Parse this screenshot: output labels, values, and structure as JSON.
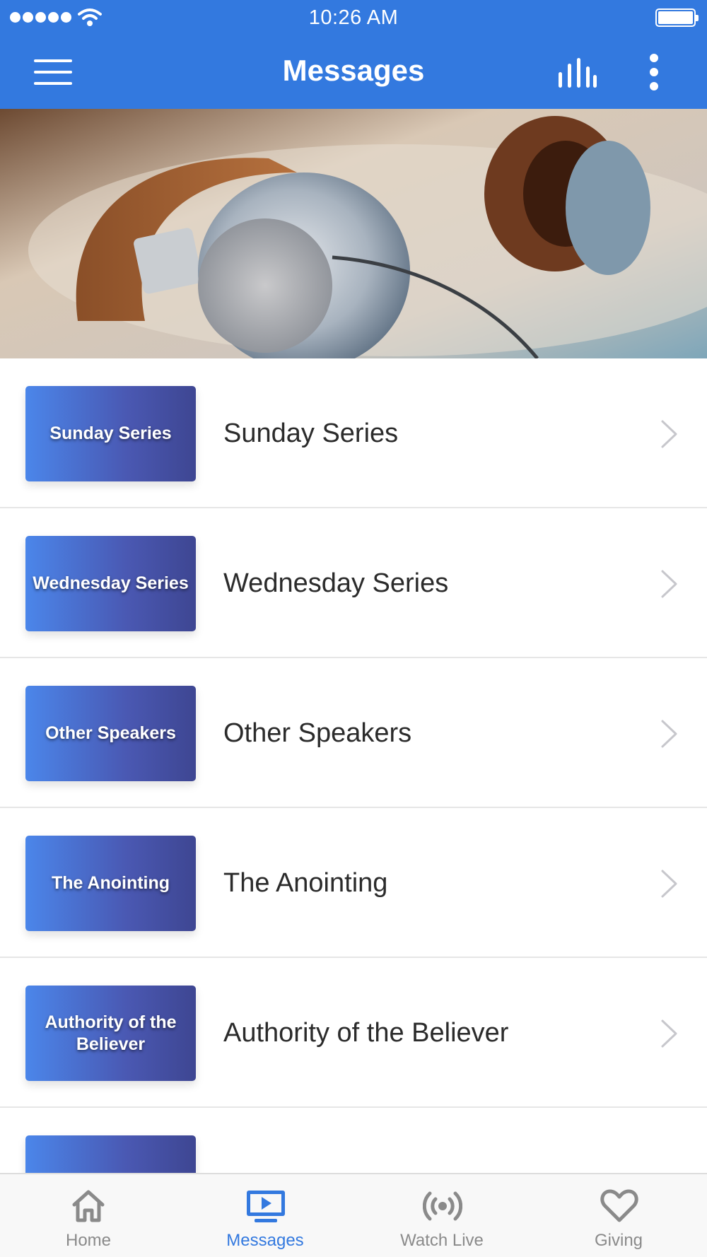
{
  "status_bar": {
    "time": "10:26 AM"
  },
  "header": {
    "title": "Messages",
    "menu_icon": "hamburger-menu-icon",
    "stats_icon": "equalizer-bars-icon",
    "more_icon": "more-vertical-icon"
  },
  "colors": {
    "accent": "#3379df",
    "tab_inactive": "#8a8a8a",
    "thumb_gradient_start": "#4b86ea",
    "thumb_gradient_end": "#3e4692"
  },
  "list": {
    "items": [
      {
        "thumb_text": "Sunday Series",
        "title": "Sunday Series"
      },
      {
        "thumb_text": "Wednesday Series",
        "title": "Wednesday Series"
      },
      {
        "thumb_text": "Other Speakers",
        "title": "Other Speakers"
      },
      {
        "thumb_text": "The Anointing",
        "title": "The Anointing"
      },
      {
        "thumb_text": "Authority of the Believer",
        "title": "Authority of the Believer"
      },
      {
        "thumb_text": "",
        "title": ""
      }
    ]
  },
  "tabbar": {
    "tabs": [
      {
        "label": "Home",
        "icon": "home-icon",
        "active": false
      },
      {
        "label": "Messages",
        "icon": "tv-play-icon",
        "active": true
      },
      {
        "label": "Watch Live",
        "icon": "broadcast-icon",
        "active": false
      },
      {
        "label": "Giving",
        "icon": "heart-icon",
        "active": false
      }
    ]
  }
}
